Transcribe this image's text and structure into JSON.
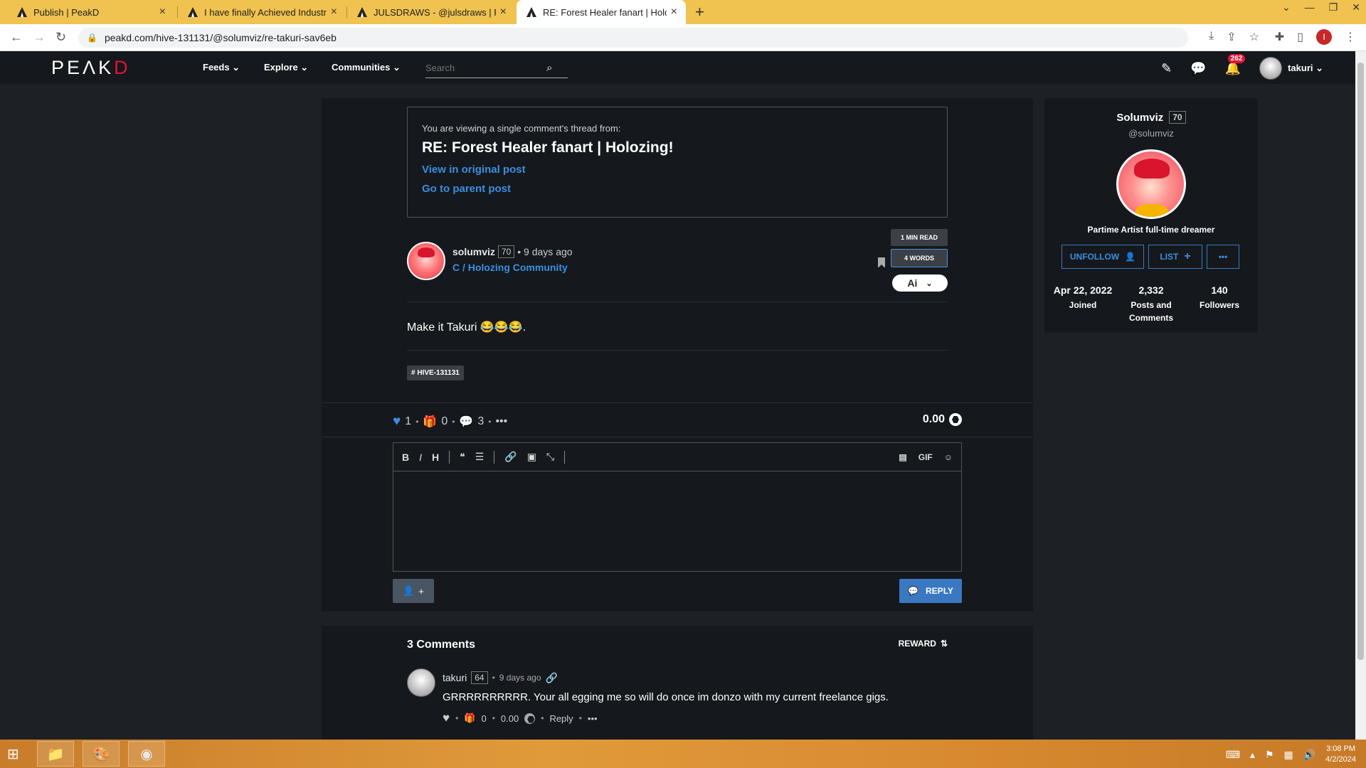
{
  "browser": {
    "tabs": [
      {
        "title": "Publish | PeakD"
      },
      {
        "title": "I have finally Achieved Industry L"
      },
      {
        "title": "JULSDRAWS - @julsdraws | PeakD"
      },
      {
        "title": "RE: Forest Healer fanart | Holozin"
      }
    ],
    "url": "peakd.com/hive-131131/@solumviz/re-takuri-sav6eb"
  },
  "header": {
    "brand_main": "PEAKD",
    "nav": {
      "feeds": "Feeds ⌄",
      "explore": "Explore ⌄",
      "communities": "Communities ⌄"
    },
    "search_placeholder": "Search",
    "notifications": "262",
    "username": "takuri ⌄"
  },
  "thread": {
    "pre": "You are viewing a single comment's thread from:",
    "title": "RE: Forest Healer fanart | Holozing!",
    "link_original": "View in original post",
    "link_parent": "Go to parent post"
  },
  "post": {
    "author": "solumviz",
    "reputation": "70",
    "time": "• 9 days ago",
    "community": "C / Holozing Community",
    "read_time": "1 MIN READ",
    "words": "4 WORDS",
    "ai_label": "Ai",
    "body": "Make it Takuri 😂😂😂.",
    "tag": "# HIVE-131131",
    "votes": "1",
    "reblogs": "0",
    "comments": "3",
    "payout": "0.00"
  },
  "editor": {
    "gif_label": "GIF",
    "reply_label": "REPLY"
  },
  "comments": {
    "title": "3 Comments",
    "sort_label": "REWARD",
    "items": [
      {
        "author": "takuri",
        "reputation": "64",
        "time": "9 days ago",
        "body": "GRRRRRRRRRR. Your all egging me so will do once im donzo with my current freelance gigs.",
        "reblogs": "0",
        "payout": "0.00",
        "reply_label": "Reply"
      }
    ]
  },
  "profile": {
    "name": "Solumviz",
    "reputation": "70",
    "handle": "@solumviz",
    "bio": "Partime Artist full-time dreamer",
    "unfollow_label": "UNFOLLOW",
    "list_label": "LIST",
    "stats": [
      {
        "value": "Apr 22, 2022",
        "label": "Joined"
      },
      {
        "value": "2,332",
        "label": "Posts and Comments"
      },
      {
        "value": "140",
        "label": "Followers"
      }
    ]
  },
  "taskbar": {
    "time": "3:08 PM",
    "date": "4/2/2024"
  },
  "colors": {
    "accent_blue": "#3a8fe0",
    "brand_red": "#e31337",
    "page_bg": "#1d2126",
    "card_bg": "#15181c",
    "tab_strip": "#f0c24f"
  }
}
